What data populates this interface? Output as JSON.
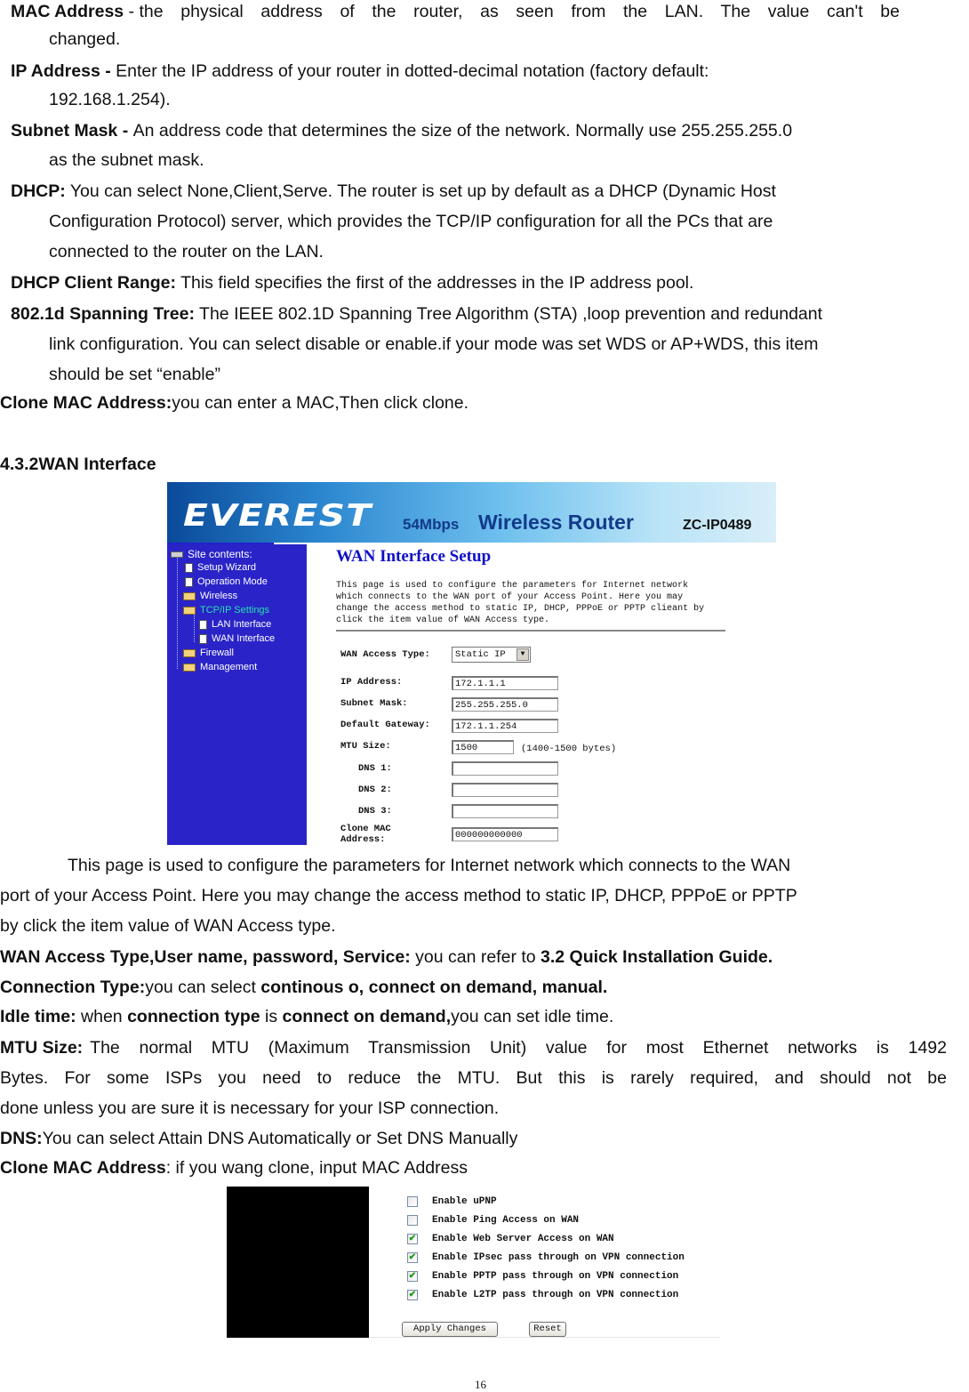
{
  "definitions_lan": [
    {
      "term": "MAC Address",
      "sep": " - ",
      "lines": [
        "the physical address of the router, as seen from the LAN. The value can't be",
        "changed."
      ]
    },
    {
      "term": "IP Address - ",
      "lines": [
        "Enter the IP address of your router in dotted-decimal notation (factory default:",
        "192.168.1.254)."
      ]
    },
    {
      "term": "Subnet Mask - ",
      "lines": [
        "An address code that determines the size of the network. Normally use 255.255.255.0",
        "as the subnet mask."
      ]
    },
    {
      "term": "DHCP:",
      "lines": [
        " You can select None,Client,Serve. The router is set up by default as a DHCP (Dynamic Host",
        "Configuration Protocol) server, which provides the TCP/IP configuration for all the PCs that are",
        "connected to the router on the LAN."
      ]
    },
    {
      "term": "DHCP Client Range:",
      "lines": [
        " This field specifies the first of the addresses in the IP address pool."
      ]
    },
    {
      "term": "802.1d Spanning Tree:",
      "lines": [
        " The IEEE 802.1D Spanning Tree Algorithm (STA) ,loop prevention and redundant",
        "link configuration. You  can select disable or enable.if your mode was set WDS or AP+WDS, this item",
        "should be set “enable”"
      ]
    },
    {
      "term": "Clone MAC Address:",
      "lines": [
        "you can enter a MAC,Then click clone."
      ]
    }
  ],
  "section_heading": "4.3.2WAN Interface",
  "router_ui": {
    "banner": {
      "logo": "EVEREST",
      "speed": "54Mbps",
      "product": "Wireless Router",
      "model": "ZC-IP0489"
    },
    "sidebar": {
      "root": "Site contents:",
      "items": [
        {
          "label": "Setup Wizard",
          "type": "doc"
        },
        {
          "label": "Operation Mode",
          "type": "doc"
        },
        {
          "label": "Wireless",
          "type": "folder"
        },
        {
          "label": "TCP/IP Settings",
          "type": "folder-open",
          "active": true
        },
        {
          "label": "LAN Interface",
          "type": "doc",
          "child": true
        },
        {
          "label": "WAN Interface",
          "type": "doc",
          "child": true
        },
        {
          "label": "Firewall",
          "type": "folder"
        },
        {
          "label": "Management",
          "type": "folder"
        }
      ]
    },
    "page_title": "WAN Interface Setup",
    "page_desc": "This page is used to configure the parameters for Internet network\nwhich connects to the WAN port of your Access Point. Here you may\nchange the access method to static IP, DHCP, PPPoE or PPTP clieant by\nclick the item value of WAN Access type.",
    "access_type_label": "WAN Access Type:",
    "access_type_value": "Static IP",
    "fields": {
      "ip_label": "IP Address:",
      "ip_value": "172.1.1.1",
      "mask_label": "Subnet Mask:",
      "mask_value": "255.255.255.0",
      "gw_label": "Default Gateway:",
      "gw_value": "172.1.1.254",
      "mtu_label": "MTU Size:",
      "mtu_value": "1500",
      "mtu_hint": "(1400-1500 bytes)",
      "dns1_label": "DNS 1:",
      "dns1_value": "",
      "dns2_label": "DNS 2:",
      "dns2_value": "",
      "dns3_label": "DNS 3:",
      "dns3_value": "",
      "clone_label": "Clone MAC\nAddress:",
      "clone_value": "000000000000"
    }
  },
  "wan_desc": {
    "intro_lines": [
      "This page is used to configure the parameters for Internet network which connects to the WAN",
      "port of your Access Point. Here you may change the access method to static IP, DHCP, PPPoE or PPTP",
      "by click the item value of WAN Access type."
    ],
    "access_term": "WAN Access Type,User name, password, Service:",
    "access_text": " you can refer to ",
    "access_ref": "3.2 Quick Installation Guide.",
    "conn_term": "Connection Type:",
    "conn_text": "you can select ",
    "conn_options": "continous o, connect on demand, manual.",
    "idle_term": "Idle time:",
    "idle_text1": " when ",
    "idle_b1": "connection type",
    "idle_text2": " is ",
    "idle_b2": "connect on demand,",
    "idle_text3": "you can set idle time.",
    "mtu_term": "MTU Size:",
    "mtu_line1": "The normal MTU (Maximum Transmission Unit) value for most Ethernet networks is 1492",
    "mtu_line2": "Bytes. For some ISPs you need to reduce the MTU. But this is rarely required, and should not be",
    "mtu_line3": "done unless you are sure it is necessary for your ISP connection.",
    "dns_term": "DNS:",
    "dns_text": "You can select Attain DNS Automatically or Set DNS Manually",
    "clone_term": "Clone MAC Address",
    "clone_text": ":  if you wang  clone, input MAC Address"
  },
  "options_ui": {
    "checkboxes": [
      {
        "label": "Enable uPNP",
        "checked": false
      },
      {
        "label": "Enable Ping Access on WAN",
        "checked": false
      },
      {
        "label": "Enable Web Server Access on WAN",
        "checked": true
      },
      {
        "label": "Enable IPsec pass through on VPN connection",
        "checked": true
      },
      {
        "label": "Enable PPTP pass through on VPN connection",
        "checked": true
      },
      {
        "label": "Enable L2TP pass through on VPN connection",
        "checked": true
      }
    ],
    "apply_label": "Apply Changes",
    "reset_label": "Reset",
    "check_glyph": "✔"
  },
  "page_number": "16"
}
